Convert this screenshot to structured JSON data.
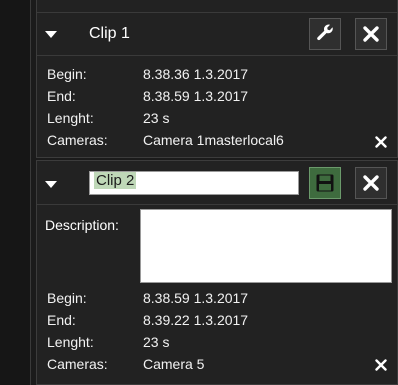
{
  "clips": [
    {
      "title": "Clip 1",
      "begin_label": "Begin:",
      "begin_value": "8.38.36 1.3.2017",
      "end_label": "End:",
      "end_value": "8.38.59 1.3.2017",
      "length_label": "Lenght:",
      "length_value": "23 s",
      "cameras_label": "Cameras:",
      "cameras_value": "Camera 1masterlocal6"
    },
    {
      "name_value": "Clip 2",
      "description_label": "Description:",
      "description_value": "",
      "begin_label": "Begin:",
      "begin_value": "8.38.59 1.3.2017",
      "end_label": "End:",
      "end_value": "8.39.22 1.3.2017",
      "length_label": "Lenght:",
      "length_value": "23 s",
      "cameras_label": "Cameras:",
      "cameras_value": "Camera 5"
    }
  ],
  "icons": {
    "collapse": "caret-down-icon",
    "edit": "wrench-icon",
    "save": "floppy-disk-icon",
    "close": "close-icon",
    "remove_camera": "close-icon"
  },
  "colors": {
    "background": "#1b1b1b",
    "panel": "#222222",
    "save_button": "#3e6b3e",
    "text_selection": "#bfd8b8"
  }
}
